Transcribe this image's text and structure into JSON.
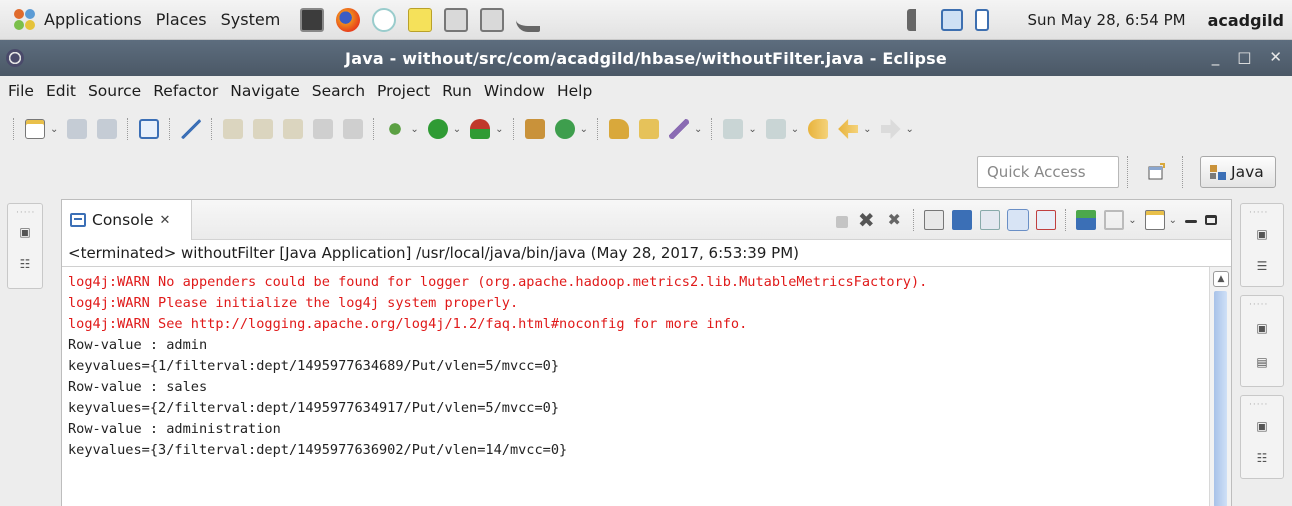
{
  "panel": {
    "menus": [
      "Applications",
      "Places",
      "System"
    ],
    "clock": "Sun May 28,  6:54 PM",
    "user": "acadgild"
  },
  "window": {
    "title": "Java - without/src/com/acadgild/hbase/withoutFilter.java - Eclipse",
    "controls": [
      "_",
      "□",
      "✕"
    ]
  },
  "menubar": [
    "File",
    "Edit",
    "Source",
    "Refactor",
    "Navigate",
    "Search",
    "Project",
    "Run",
    "Window",
    "Help"
  ],
  "quick_access": {
    "placeholder": "Quick Access"
  },
  "perspective": {
    "label": "Java"
  },
  "console": {
    "tab_label": "Console",
    "tab_close": "✕",
    "description": "<terminated> withoutFilter [Java Application] /usr/local/java/bin/java (May 28, 2017, 6:53:39 PM)",
    "lines": [
      {
        "type": "err",
        "text": "log4j:WARN No appenders could be found for logger (org.apache.hadoop.metrics2.lib.MutableMetricsFactory)."
      },
      {
        "type": "err",
        "text": "log4j:WARN Please initialize the log4j system properly."
      },
      {
        "type": "err",
        "text": "log4j:WARN See http://logging.apache.org/log4j/1.2/faq.html#noconfig for more info."
      },
      {
        "type": "out",
        "text": "Row-value : admin"
      },
      {
        "type": "out",
        "text": "keyvalues={1/filterval:dept/1495977634689/Put/vlen=5/mvcc=0}"
      },
      {
        "type": "out",
        "text": "Row-value : sales"
      },
      {
        "type": "out",
        "text": "keyvalues={2/filterval:dept/1495977634917/Put/vlen=5/mvcc=0}"
      },
      {
        "type": "out",
        "text": "Row-value : administration"
      },
      {
        "type": "out",
        "text": "keyvalues={3/filterval:dept/1495977636902/Put/vlen=14/mvcc=0}"
      }
    ]
  },
  "colors": {
    "error_text": "#e01a1a",
    "titlebar": "#515e6c",
    "accent": "#3b6fb6"
  }
}
